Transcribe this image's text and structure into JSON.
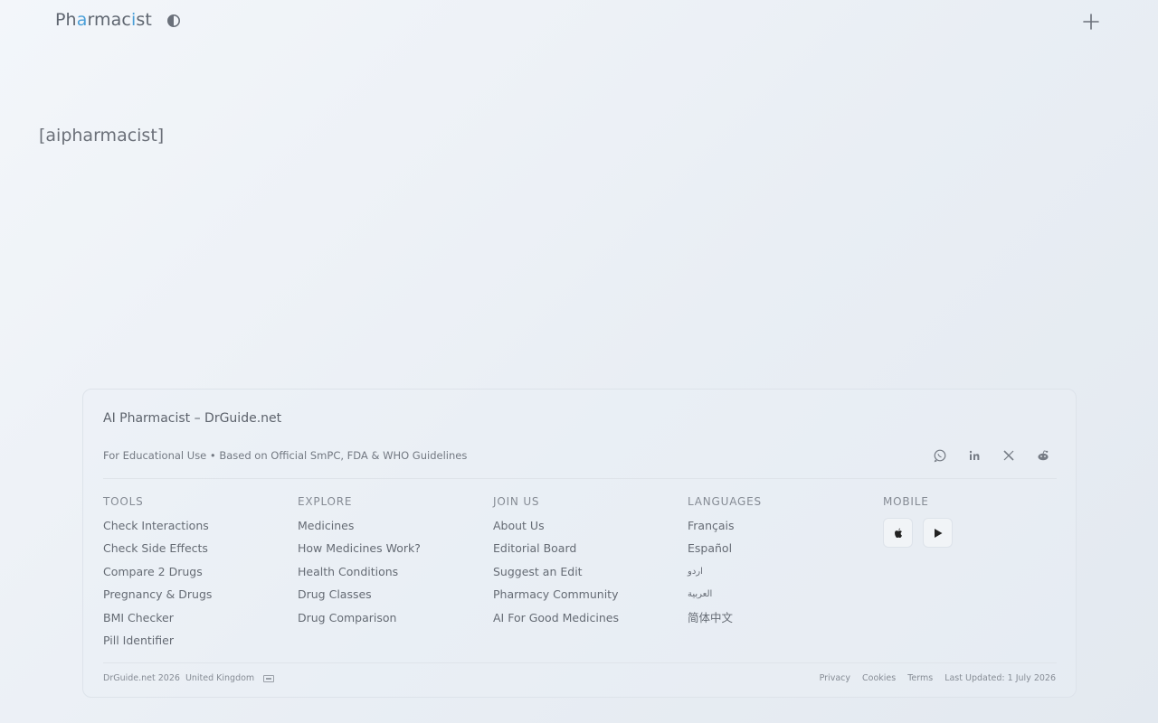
{
  "header": {
    "logo_prefix": "Ph",
    "logo_accent1": "a",
    "logo_mid": "rmac",
    "logo_accent2": "i",
    "logo_suffix": "st",
    "theme_icon": "half-circle-icon",
    "menu_icon": "plus-icon"
  },
  "main": {
    "placeholder_text": "[aipharmacist]"
  },
  "footer": {
    "title": "AI Pharmacist – DrGuide.net",
    "subtitle": "For Educational Use • Based on Official SmPC, FDA & WHO Guidelines",
    "social_icons": [
      "whatsapp-icon",
      "linkedin-icon",
      "x-icon",
      "reddit-icon"
    ],
    "columns": {
      "tools": {
        "heading": "TOOLS",
        "links": [
          "Check Interactions",
          "Check Side Effects",
          "Compare 2 Drugs",
          "Pregnancy & Drugs",
          "BMI Checker",
          "Pill Identifier"
        ]
      },
      "explore": {
        "heading": "EXPLORE",
        "links": [
          "Medicines",
          "How Medicines Work?",
          "Health Conditions",
          "Drug Classes",
          "Drug Comparison"
        ]
      },
      "join": {
        "heading": "JOIN US",
        "links": [
          "About Us",
          "Editorial Board",
          "Suggest an Edit",
          "Pharmacy Community",
          "AI For Good Medicines"
        ]
      },
      "languages": {
        "heading": "LANGUAGES",
        "links": [
          "Français",
          "Español",
          "اردو",
          "العربية",
          "简体中文"
        ]
      },
      "mobile": {
        "heading": "MOBILE",
        "stores": [
          "apple-icon",
          "google-play-icon"
        ]
      }
    },
    "bottom": {
      "copyright": "DrGuide.net 2026",
      "country": "United Kingdom",
      "privacy": "Privacy",
      "cookies": "Cookies",
      "terms": "Terms",
      "updated": "Last Updated: 1 July 2026"
    }
  },
  "colors": {
    "accent": "#4a9fd8",
    "text": "#656b74",
    "background": "#eef2f6"
  }
}
